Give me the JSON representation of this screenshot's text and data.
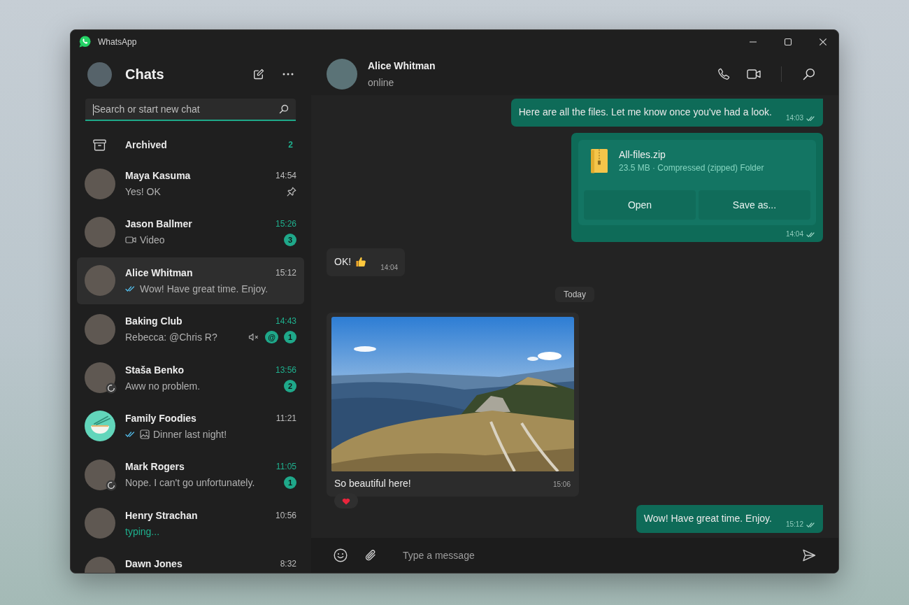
{
  "window": {
    "title": "WhatsApp"
  },
  "sidebar": {
    "heading": "Chats",
    "search": {
      "placeholder": "Search or start new chat"
    },
    "archived": {
      "label": "Archived",
      "count": "2"
    },
    "chats": [
      {
        "name": "Maya Kasuma",
        "time": "14:54",
        "avatar": {
          "kind": "photo"
        },
        "preview": {
          "kind": "message",
          "text": "Yes! OK",
          "read": false
        },
        "selected": false,
        "unread": false,
        "pinned": true,
        "muted": false,
        "status_update": false
      },
      {
        "name": "Jason Ballmer",
        "time": "15:26",
        "avatar": {
          "kind": "photo"
        },
        "preview": {
          "kind": "message",
          "text": "Video",
          "read": false,
          "attachment": {
            "kind": "video"
          }
        },
        "selected": false,
        "unread": true,
        "unread_count": "3",
        "pinned": false,
        "muted": false,
        "status_update": false
      },
      {
        "name": "Alice Whitman",
        "time": "15:12",
        "avatar": {
          "kind": "photo"
        },
        "preview": {
          "kind": "message",
          "text": "Wow! Have great time. Enjoy.",
          "read": true
        },
        "selected": true,
        "unread": false,
        "pinned": false,
        "muted": false,
        "status_update": false
      },
      {
        "name": "Baking Club",
        "time": "14:43",
        "avatar": {
          "kind": "photo"
        },
        "preview": {
          "kind": "message",
          "text": "Rebecca: @Chris R?",
          "read": false
        },
        "selected": false,
        "unread": true,
        "unread_count": "1",
        "mention": "@",
        "pinned": false,
        "muted": true,
        "status_update": false
      },
      {
        "name": "Staša Benko",
        "time": "13:56",
        "avatar": {
          "kind": "photo"
        },
        "preview": {
          "kind": "message",
          "text": "Aww no problem.",
          "read": false
        },
        "selected": false,
        "unread": true,
        "unread_count": "2",
        "pinned": false,
        "muted": false,
        "status_update": true
      },
      {
        "name": "Family Foodies",
        "time": "11:21",
        "avatar": {
          "kind": "group"
        },
        "preview": {
          "kind": "message",
          "text": "Dinner last night!",
          "read": true,
          "attachment": {
            "kind": "photo"
          }
        },
        "selected": false,
        "unread": false,
        "pinned": false,
        "muted": false,
        "status_update": false
      },
      {
        "name": "Mark Rogers",
        "time": "11:05",
        "avatar": {
          "kind": "photo"
        },
        "preview": {
          "kind": "message",
          "text": "Nope. I can't go unfortunately.",
          "read": false
        },
        "selected": false,
        "unread": true,
        "unread_count": "1",
        "pinned": false,
        "muted": false,
        "status_update": true
      },
      {
        "name": "Henry Strachan",
        "time": "10:56",
        "avatar": {
          "kind": "photo"
        },
        "preview": {
          "kind": "typing",
          "text": "typing...",
          "read": false
        },
        "selected": false,
        "unread": false,
        "pinned": false,
        "muted": false,
        "status_update": false
      },
      {
        "name": "Dawn Jones",
        "time": "8:32",
        "avatar": {
          "kind": "photo"
        },
        "selected": false,
        "unread": false,
        "pinned": false,
        "muted": false,
        "status_update": false
      }
    ]
  },
  "chat": {
    "contact": {
      "name": "Alice Whitman",
      "status": "online"
    },
    "messages": [
      {
        "kind": "text",
        "outgoing": true,
        "text": "Here are all the files. Let me know once you've had a look.",
        "emoji": false,
        "time": "14:03",
        "delivered": true
      },
      {
        "kind": "file",
        "outgoing": true,
        "file_name": "All-files.zip",
        "details": "23.5 MB · Compressed (zipped) Folder",
        "actions": [
          "Open",
          "Save as..."
        ],
        "time": "14:04",
        "delivered": true
      },
      {
        "kind": "text",
        "outgoing": false,
        "text": "OK!",
        "emoji": true,
        "time": "14:04"
      },
      {
        "kind": "date",
        "text": "Today"
      },
      {
        "kind": "image",
        "outgoing": false,
        "caption": "So beautiful here!",
        "time": "15:06",
        "reacted": true
      },
      {
        "kind": "text",
        "outgoing": true,
        "text": "Wow! Have great time. Enjoy.",
        "emoji": false,
        "time": "15:12",
        "delivered": true
      }
    ],
    "composer": {
      "placeholder": "Type a message"
    }
  }
}
